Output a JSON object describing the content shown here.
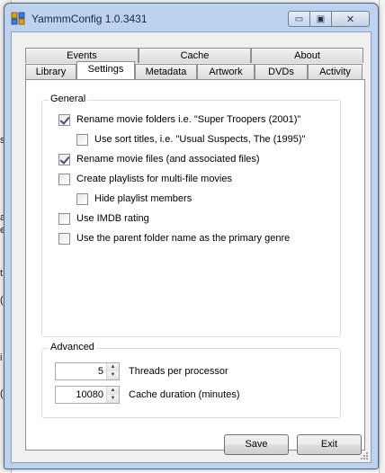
{
  "window": {
    "title": "YammmConfig 1.0.3431"
  },
  "caption_buttons": {
    "minimize": "▭",
    "maximize": "▣",
    "close": "✕"
  },
  "tabs": {
    "row_top": [
      {
        "label": "Events"
      },
      {
        "label": "Cache"
      },
      {
        "label": "About"
      }
    ],
    "row_bottom": [
      {
        "label": "Library"
      },
      {
        "label": "Settings",
        "active": true
      },
      {
        "label": "Metadata"
      },
      {
        "label": "Artwork"
      },
      {
        "label": "DVDs"
      },
      {
        "label": "Activity"
      }
    ]
  },
  "general": {
    "title": "General",
    "options": [
      {
        "label": "Rename movie folders i.e. \"Super Troopers (2001)\"",
        "checked": true
      },
      {
        "label": "Use sort titles, i.e. \"Usual Suspects, The (1995)\"",
        "checked": false
      },
      {
        "label": "Rename movie files (and associated files)",
        "checked": true
      },
      {
        "label": "Create playlists for multi-file movies",
        "checked": false
      },
      {
        "label": "Hide playlist members",
        "checked": false
      },
      {
        "label": "Use IMDB rating",
        "checked": false
      },
      {
        "label": "Use the parent folder name as the primary genre",
        "checked": false
      }
    ]
  },
  "advanced": {
    "title": "Advanced",
    "threads": {
      "value": "5",
      "label": "Threads per processor"
    },
    "cache_duration": {
      "value": "10080",
      "label": "Cache duration (minutes)"
    }
  },
  "buttons": {
    "save": "Save",
    "exit": "Exit"
  },
  "background_marks": [
    "s",
    "a",
    "e",
    "t",
    "(",
    "i",
    "("
  ]
}
